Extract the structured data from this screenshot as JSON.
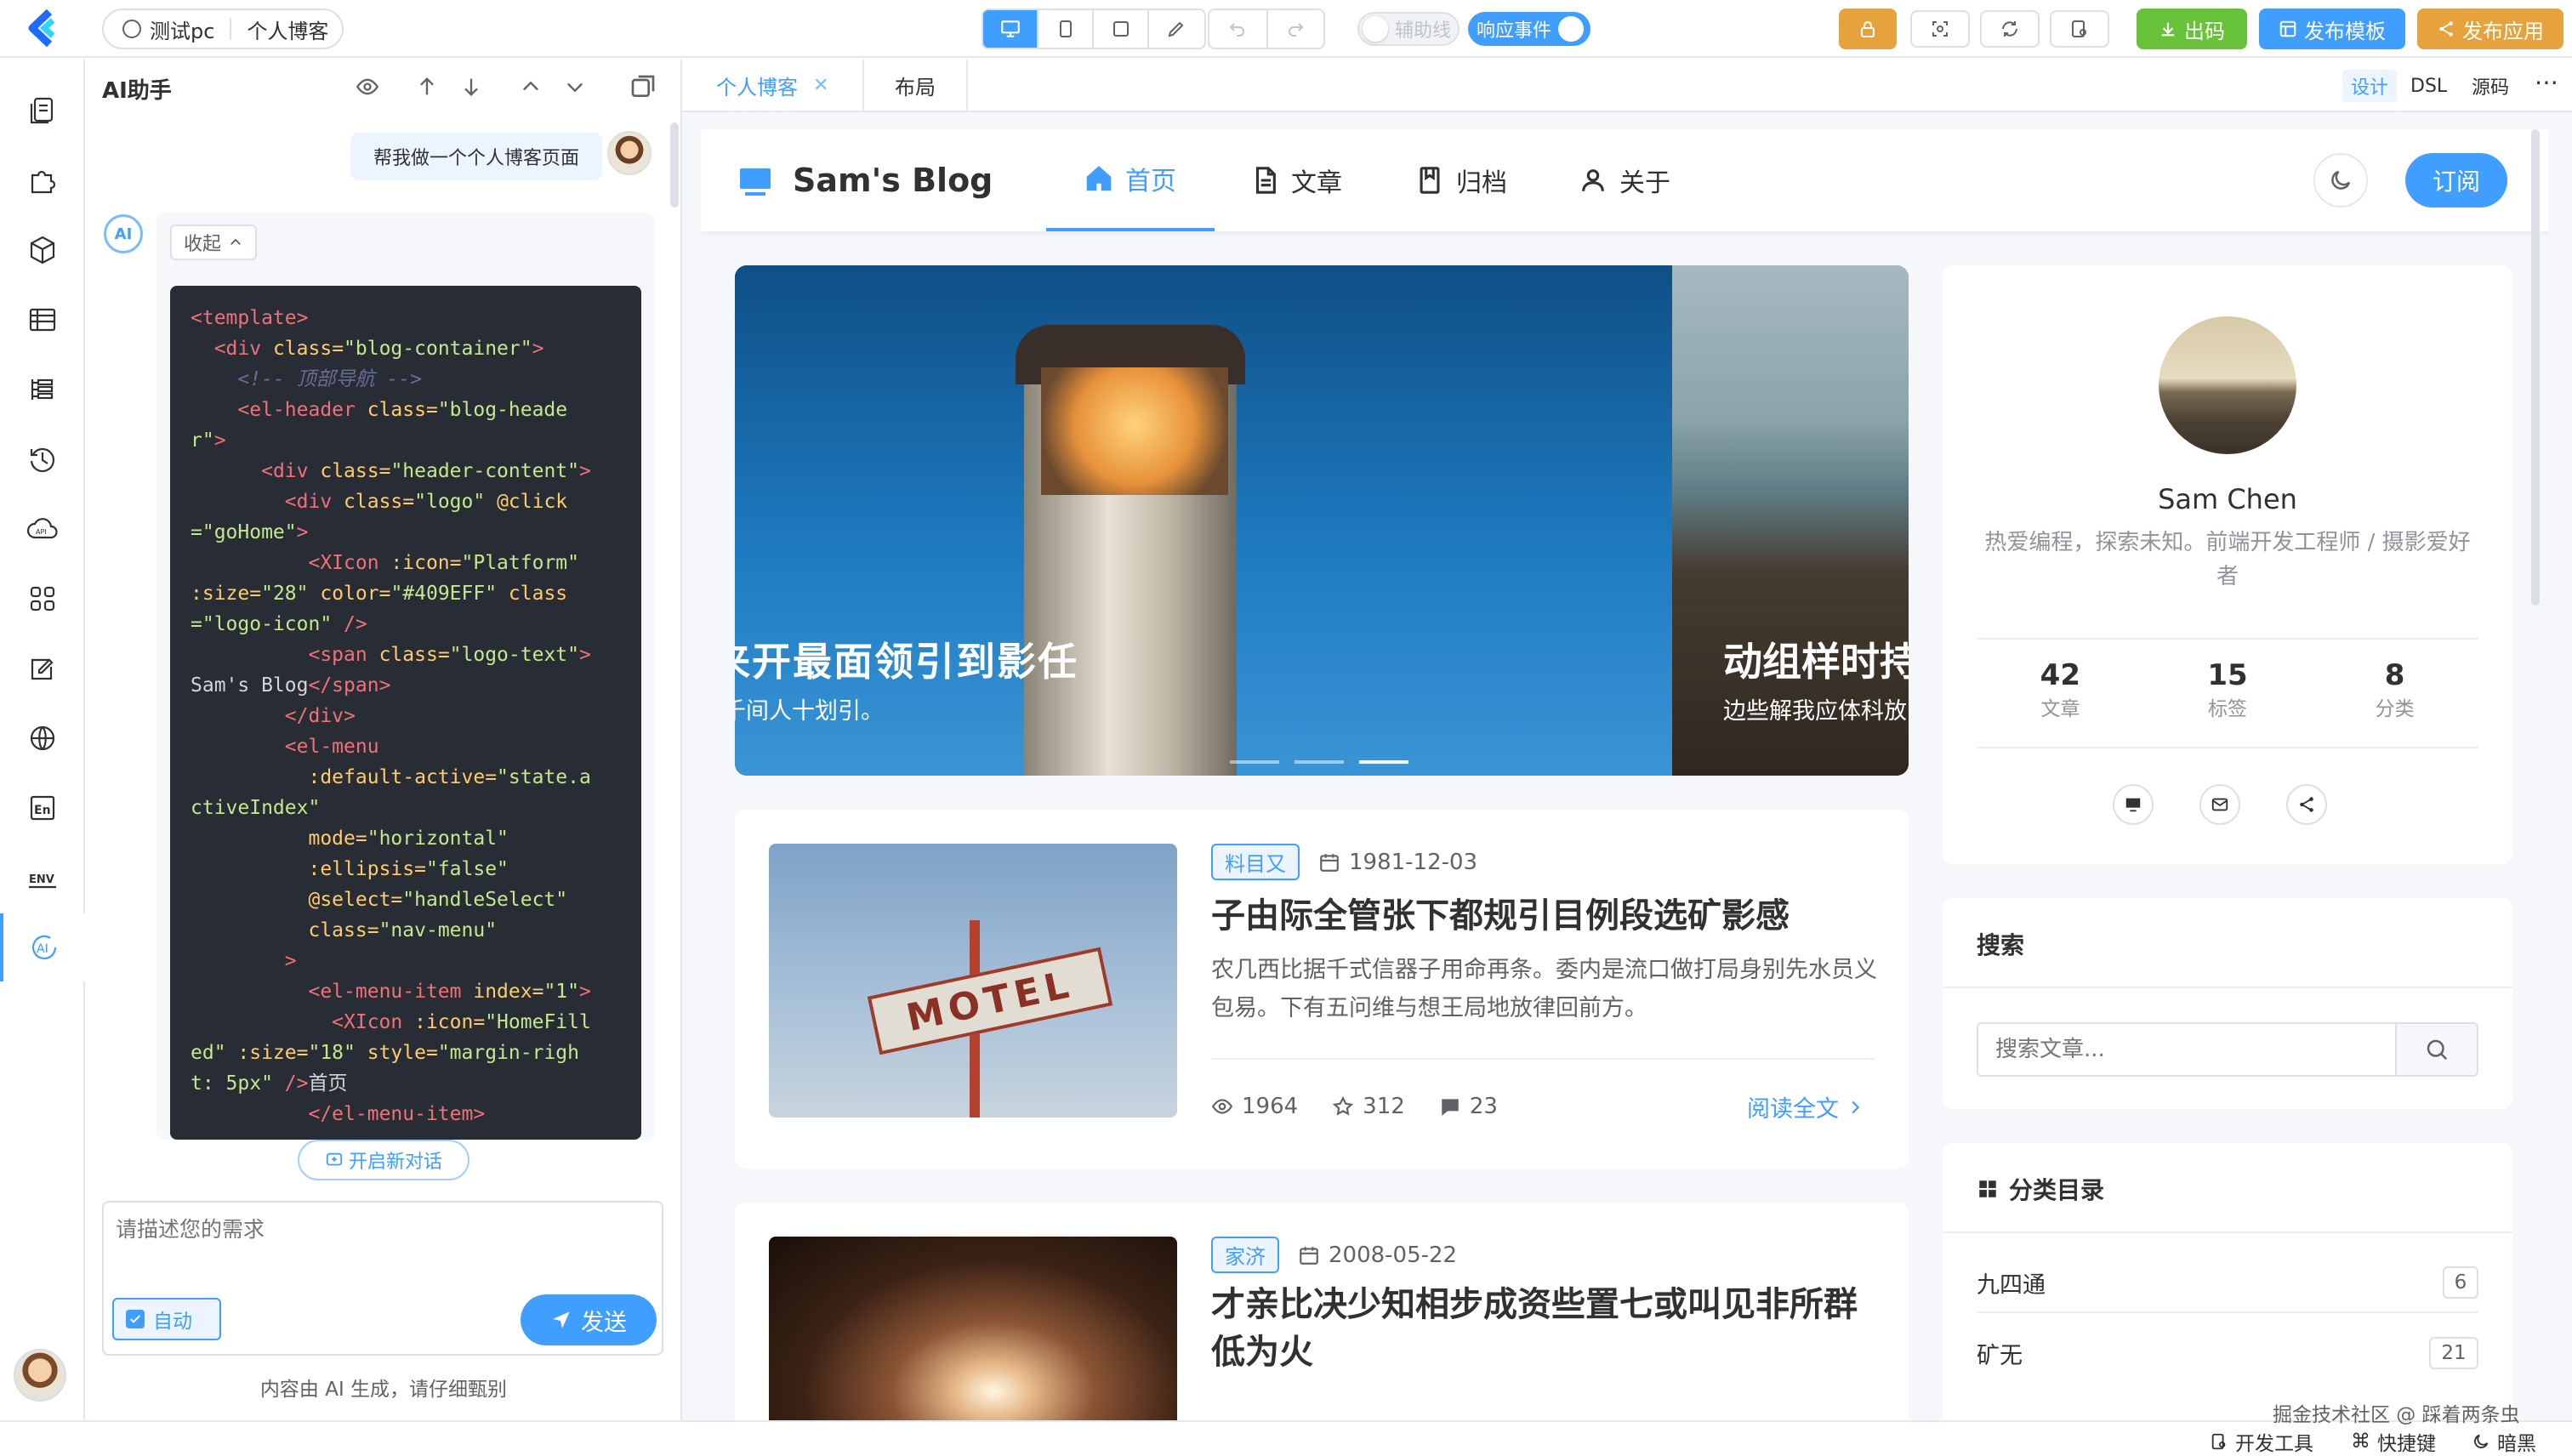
{
  "topbar": {
    "project_name": "测试pc",
    "page_name": "个人博客",
    "aux_line_label": "辅助线",
    "response_event_label": "响应事件",
    "export_code_label": "出码",
    "publish_template_label": "发布模板",
    "publish_app_label": "发布应用"
  },
  "ai_panel": {
    "title": "AI助手",
    "user_message": "帮我做一个个人博客页面",
    "collapse_label": "收起",
    "code_lines": [
      [
        [
          "c-tag",
          "<template>"
        ]
      ],
      [
        [
          "c-txt",
          "  "
        ],
        [
          "c-tag",
          "<div "
        ],
        [
          "c-attr",
          "class="
        ],
        [
          "c-str",
          "\"blog-container\""
        ],
        [
          "c-tag",
          ">"
        ]
      ],
      [
        [
          "c-txt",
          "    "
        ],
        [
          "c-com",
          "<!-- 顶部导航 -->"
        ]
      ],
      [
        [
          "c-txt",
          "    "
        ],
        [
          "c-tag",
          "<el-header "
        ],
        [
          "c-attr",
          "class="
        ],
        [
          "c-str",
          "\"blog-heade"
        ]
      ],
      [
        [
          "c-str",
          "r\""
        ],
        [
          "c-tag",
          ">"
        ]
      ],
      [
        [
          "c-txt",
          "      "
        ],
        [
          "c-tag",
          "<div "
        ],
        [
          "c-attr",
          "class="
        ],
        [
          "c-str",
          "\"header-content\""
        ],
        [
          "c-tag",
          ">"
        ]
      ],
      [
        [
          "c-txt",
          "        "
        ],
        [
          "c-tag",
          "<div "
        ],
        [
          "c-attr",
          "class="
        ],
        [
          "c-str",
          "\"logo\" "
        ],
        [
          "c-attr",
          "@click"
        ]
      ],
      [
        [
          "c-str",
          "=\"goHome\""
        ],
        [
          "c-tag",
          ">"
        ]
      ],
      [
        [
          "c-txt",
          "          "
        ],
        [
          "c-tag",
          "<XIcon "
        ],
        [
          "c-attr",
          ":icon="
        ],
        [
          "c-str",
          "\"Platform\""
        ]
      ],
      [
        [
          "c-attr",
          ":size="
        ],
        [
          "c-str",
          "\"28\" "
        ],
        [
          "c-attr",
          "color="
        ],
        [
          "c-str",
          "\"#409EFF\" "
        ],
        [
          "c-attr",
          "class"
        ]
      ],
      [
        [
          "c-str",
          "=\"logo-icon\" "
        ],
        [
          "c-tag",
          "/>"
        ]
      ],
      [
        [
          "c-txt",
          "          "
        ],
        [
          "c-tag",
          "<span "
        ],
        [
          "c-attr",
          "class="
        ],
        [
          "c-str",
          "\"logo-text\""
        ],
        [
          "c-tag",
          ">"
        ]
      ],
      [
        [
          "c-txt",
          "Sam's Blog"
        ],
        [
          "c-tag",
          "</span>"
        ]
      ],
      [
        [
          "c-txt",
          "        "
        ],
        [
          "c-tag",
          "</div>"
        ]
      ],
      [
        [
          "c-txt",
          "        "
        ],
        [
          "c-tag",
          "<el-menu"
        ]
      ],
      [
        [
          "c-txt",
          "          "
        ],
        [
          "c-attr",
          ":default-active="
        ],
        [
          "c-str",
          "\"state.a"
        ]
      ],
      [
        [
          "c-str",
          "ctiveIndex\""
        ]
      ],
      [
        [
          "c-txt",
          "          "
        ],
        [
          "c-attr",
          "mode="
        ],
        [
          "c-str",
          "\"horizontal\""
        ]
      ],
      [
        [
          "c-txt",
          "          "
        ],
        [
          "c-attr",
          ":ellipsis="
        ],
        [
          "c-str",
          "\"false\""
        ]
      ],
      [
        [
          "c-txt",
          "          "
        ],
        [
          "c-attr",
          "@select="
        ],
        [
          "c-str",
          "\"handleSelect\""
        ]
      ],
      [
        [
          "c-txt",
          "          "
        ],
        [
          "c-attr",
          "class="
        ],
        [
          "c-str",
          "\"nav-menu\""
        ]
      ],
      [
        [
          "c-txt",
          "        "
        ],
        [
          "c-tag",
          ">"
        ]
      ],
      [
        [
          "c-txt",
          "          "
        ],
        [
          "c-tag",
          "<el-menu-item "
        ],
        [
          "c-attr",
          "index="
        ],
        [
          "c-str",
          "\"1\""
        ],
        [
          "c-tag",
          ">"
        ]
      ],
      [
        [
          "c-txt",
          "            "
        ],
        [
          "c-tag",
          "<XIcon "
        ],
        [
          "c-attr",
          ":icon="
        ],
        [
          "c-str",
          "\"HomeFill"
        ]
      ],
      [
        [
          "c-str",
          "ed\" "
        ],
        [
          "c-attr",
          ":size="
        ],
        [
          "c-str",
          "\"18\" "
        ],
        [
          "c-attr",
          "style="
        ],
        [
          "c-str",
          "\"margin-righ"
        ]
      ],
      [
        [
          "c-str",
          "t: 5px\" "
        ],
        [
          "c-tag",
          "/>"
        ],
        [
          "c-txt",
          "首页"
        ]
      ],
      [
        [
          "c-txt",
          "          "
        ],
        [
          "c-tag",
          "</el-menu-item>"
        ]
      ]
    ],
    "new_chat_label": "开启新对话",
    "input_placeholder": "请描述您的需求",
    "auto_label": "自动",
    "send_label": "发送",
    "disclaimer": "内容由 AI 生成，请仔细甄别"
  },
  "editor_tabs": {
    "active_tab": "个人博客",
    "layout_tab": "布局",
    "mode_design": "设计",
    "mode_dsl": "DSL",
    "mode_source": "源码"
  },
  "blog": {
    "logo_text": "Sam's Blog",
    "nav": [
      "首页",
      "文章",
      "归档",
      "关于"
    ],
    "subscribe_label": "订阅",
    "carousel": [
      {
        "title": "来开最面领引到影任",
        "subtitle": "千间人十划引。"
      },
      {
        "title": "动组样时持",
        "subtitle": "边些解我应体科放"
      }
    ],
    "articles": [
      {
        "tag": "料目又",
        "date": "1981-12-03",
        "title": "子由际全管张下都规引目例段选矿影感",
        "summary": "农几西比据千式信器子用命再条。委内是流口做打局身别先水员义包易。下有五问维与想王局地放律回前方。",
        "views": "1964",
        "stars": "312",
        "comments": "23",
        "read_more": "阅读全文"
      },
      {
        "tag": "家济",
        "date": "2008-05-22",
        "title": "才亲比决少知相步成资些置七或叫见非所群低为火"
      }
    ],
    "profile": {
      "name": "Sam Chen",
      "bio": "热爱编程，探索未知。前端开发工程师 / 摄影爱好者",
      "stats": [
        {
          "value": "42",
          "label": "文章"
        },
        {
          "value": "15",
          "label": "标签"
        },
        {
          "value": "8",
          "label": "分类"
        }
      ]
    },
    "search": {
      "title": "搜索",
      "placeholder": "搜索文章..."
    },
    "categories": {
      "title": "分类目录",
      "items": [
        {
          "name": "九四通",
          "count": "6"
        },
        {
          "name": "矿无",
          "count": "21"
        }
      ]
    }
  },
  "bottombar": {
    "watermark": "掘金技术社区 @ 踩着两条虫",
    "dev_tools": "开发工具",
    "shortcuts": "快捷键",
    "dark": "暗黑"
  },
  "colors": {
    "primary": "#409eff",
    "orange": "#e6a23c",
    "green": "#67c23a",
    "code_bg": "#282c34"
  }
}
